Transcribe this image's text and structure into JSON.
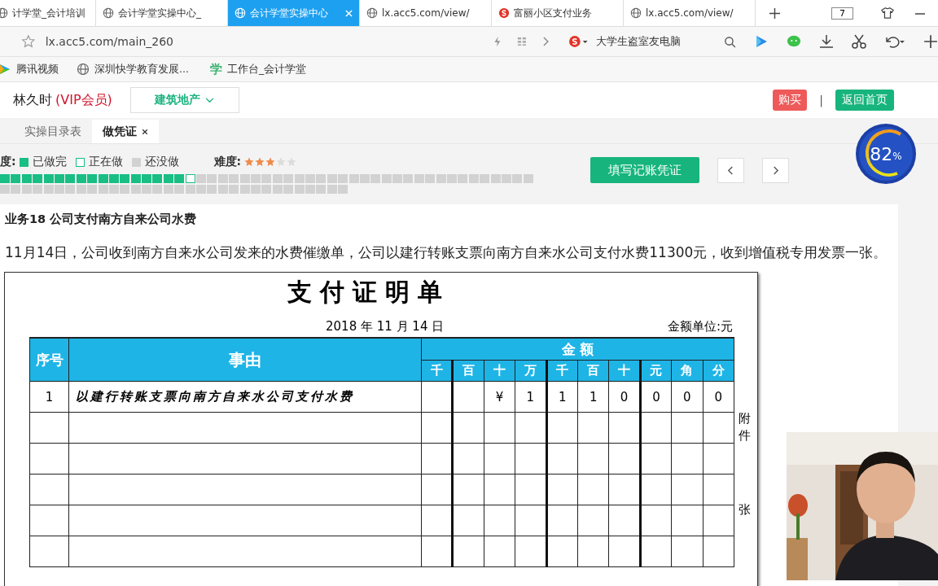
{
  "browser_tabs": [
    {
      "title": "计学堂_会计培训",
      "selected": false
    },
    {
      "title": "会计学堂实操中心_",
      "selected": false
    },
    {
      "title": "会计学堂实操中心",
      "selected": true
    },
    {
      "title": "lx.acc5.com/view/",
      "selected": false
    },
    {
      "title": "富丽小区支付业务",
      "selected": false
    },
    {
      "title": "lx.acc5.com/view/",
      "selected": false
    }
  ],
  "tab_count": "7",
  "address_bar": {
    "url": "lx.acc5.com/main_260",
    "search_text": "大学生盗室友电脑"
  },
  "bookmarks": [
    {
      "label": "腾讯视频"
    },
    {
      "label": "深圳快学教育发展..."
    },
    {
      "label": "工作台_会计学堂",
      "icon_text": "学"
    }
  ],
  "header": {
    "user_name": "林久时",
    "membership": "(VIP会员)",
    "category": "建筑地产",
    "buy_button": "购买",
    "separator": "|",
    "home_button": "返回首页"
  },
  "page_tabs": [
    {
      "label": "实操目录表",
      "selected": false
    },
    {
      "label": "做凭证",
      "selected": true
    }
  ],
  "progress": {
    "label": "度:",
    "legend": [
      {
        "kind": "done",
        "label": "已做完"
      },
      {
        "kind": "current",
        "label": "正在做"
      },
      {
        "kind": "todo",
        "label": "还没做"
      }
    ],
    "difficulty_label": "难度:",
    "stars": 3,
    "cells": [
      {
        "kind": "done"
      },
      {
        "kind": "done"
      },
      {
        "kind": "done"
      },
      {
        "kind": "done"
      },
      {
        "kind": "done"
      },
      {
        "kind": "done"
      },
      {
        "kind": "done"
      },
      {
        "kind": "done"
      },
      {
        "kind": "done"
      },
      {
        "kind": "done"
      },
      {
        "kind": "done"
      },
      {
        "kind": "done"
      },
      {
        "kind": "done"
      },
      {
        "kind": "done"
      },
      {
        "kind": "done"
      },
      {
        "kind": "done"
      },
      {
        "kind": "done"
      },
      {
        "kind": "current"
      },
      {
        "kind": "todo"
      },
      {
        "kind": "todo"
      },
      {
        "kind": "todo"
      },
      {
        "kind": "todo"
      },
      {
        "kind": "todo"
      },
      {
        "kind": "todo"
      },
      {
        "kind": "todo"
      },
      {
        "kind": "todo"
      },
      {
        "kind": "todo"
      },
      {
        "kind": "todo"
      },
      {
        "kind": "todo"
      },
      {
        "kind": "todo"
      },
      {
        "kind": "todo"
      },
      {
        "kind": "todo"
      },
      {
        "kind": "todo"
      },
      {
        "kind": "todo"
      },
      {
        "kind": "todo"
      },
      {
        "kind": "todo"
      },
      {
        "kind": "todo"
      },
      {
        "kind": "todo"
      },
      {
        "kind": "todo"
      },
      {
        "kind": "todo"
      },
      {
        "kind": "todo"
      },
      {
        "kind": "todo"
      },
      {
        "kind": "todo"
      },
      {
        "kind": "todo"
      },
      {
        "kind": "todo"
      },
      {
        "kind": "todo"
      },
      {
        "kind": "todo"
      },
      {
        "kind": "todo"
      },
      {
        "kind": "todo"
      },
      {
        "kind": "todo"
      },
      {
        "kind": "todo"
      },
      {
        "kind": "todo"
      },
      {
        "kind": "todo"
      },
      {
        "kind": "todo"
      },
      {
        "kind": "todo"
      },
      {
        "kind": "todo"
      },
      {
        "kind": "todo"
      },
      {
        "kind": "todo"
      },
      {
        "kind": "todo"
      },
      {
        "kind": "todo"
      },
      {
        "kind": "todo"
      },
      {
        "kind": "todo"
      },
      {
        "kind": "todo"
      },
      {
        "kind": "todo"
      },
      {
        "kind": "todo"
      },
      {
        "kind": "todo"
      },
      {
        "kind": "todo"
      },
      {
        "kind": "todo"
      },
      {
        "kind": "todo"
      },
      {
        "kind": "todo"
      },
      {
        "kind": "todo"
      },
      {
        "kind": "todo"
      },
      {
        "kind": "todo"
      },
      {
        "kind": "todo"
      },
      {
        "kind": "todo"
      },
      {
        "kind": "todo"
      },
      {
        "kind": "todo"
      },
      {
        "kind": "todo"
      },
      {
        "kind": "todo"
      },
      {
        "kind": "todo"
      },
      {
        "kind": "todo"
      }
    ]
  },
  "fill_voucher_button": "填写记账凭证",
  "score": {
    "value": "82",
    "unit": "%"
  },
  "task": {
    "title": "业务18 公司支付南方自来公司水费",
    "description": "11月14日，公司收到南方自来水公司发来的水费催缴单，公司以建行转账支票向南方自来水公司支付水费11300元，收到增值税专用发票一张。"
  },
  "document": {
    "title": "支付证明单",
    "date": "2018 年  11 月  14 日",
    "unit": "金额单位:元",
    "columns": {
      "index": "序号",
      "reason": "事由",
      "amount": "金  额",
      "digits": [
        "千",
        "百",
        "十",
        "万",
        "千",
        "百",
        "十",
        "元",
        "角",
        "分"
      ]
    },
    "rows": [
      {
        "index": "1",
        "reason": "以建行转账支票向南方自来水公司支付水费",
        "currency": "¥",
        "digits": [
          "1",
          "1",
          "1",
          "0",
          "0",
          "0",
          "0"
        ]
      }
    ],
    "attachment_label": "附件",
    "attachment_unit": "张"
  }
}
